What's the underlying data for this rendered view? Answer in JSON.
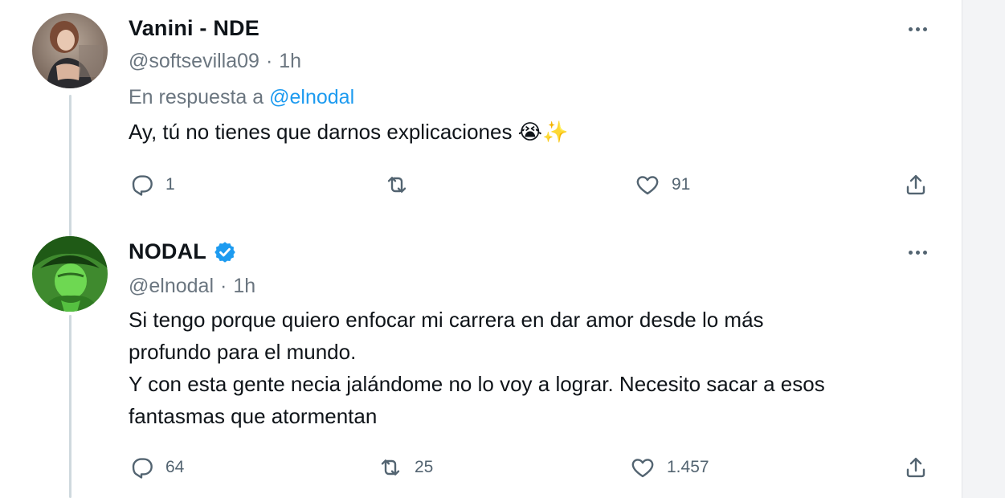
{
  "tweets": [
    {
      "name": "Vanini - NDE",
      "handle": "@softsevilla09",
      "separator": "·",
      "time": "1h",
      "reply_prefix": "En respuesta a",
      "reply_mention": "@elnodal",
      "text_lines": [
        "Ay, tú no tienes que darnos explicaciones 😭✨"
      ],
      "reply_count": "1",
      "retweet_count": "",
      "like_count": "91",
      "verified": false
    },
    {
      "name": "NODAL",
      "handle": "@elnodal",
      "separator": "·",
      "time": "1h",
      "text_lines": [
        "Si tengo porque quiero enfocar mi carrera en dar amor desde lo más",
        "profundo para el mundo.",
        "Y con esta gente necia jalándome no lo voy a lograr. Necesito sacar a esos",
        "fantasmas que atormentan"
      ],
      "reply_count": "64",
      "retweet_count": "25",
      "like_count": "1.457",
      "verified": true
    }
  ],
  "icons": {
    "reply": "reply-icon",
    "retweet": "retweet-icon",
    "like": "heart-icon",
    "share": "share-icon",
    "more": "more-icon",
    "verified": "verified-badge-icon"
  },
  "colors": {
    "link": "#1d9bf0",
    "secondary_text": "#6b7680",
    "verified": "#1d9bf0",
    "thread_line": "#cfd9de"
  }
}
